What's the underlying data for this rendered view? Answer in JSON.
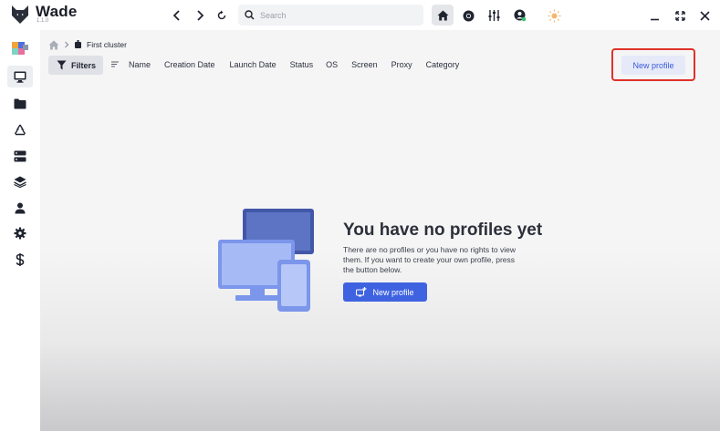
{
  "app": {
    "name": "Wade",
    "version": "1.1.0"
  },
  "search": {
    "placeholder": "Search"
  },
  "toolbar": {
    "icons": [
      "chevron-left-icon",
      "chevron-right-icon",
      "refresh-icon",
      "home-icon",
      "chrome-icon",
      "sliders-icon",
      "account-icon",
      "sun-icon",
      "minimize-icon",
      "expand-icon",
      "close-icon"
    ]
  },
  "sidebar": {
    "items": [
      {
        "icon": "avatar-grid-icon"
      },
      {
        "icon": "monitor-icon",
        "active": true
      },
      {
        "icon": "folder-icon"
      },
      {
        "icon": "recycle-icon"
      },
      {
        "icon": "server-icon"
      },
      {
        "icon": "layers-icon"
      },
      {
        "icon": "user-icon"
      },
      {
        "icon": "gear-icon"
      },
      {
        "icon": "dollar-icon"
      }
    ]
  },
  "breadcrumb": {
    "current": "First cluster"
  },
  "filters": {
    "label": "Filters"
  },
  "columns": [
    "Name",
    "Creation Date",
    "Launch Date",
    "Status",
    "OS",
    "Screen",
    "Proxy",
    "Category"
  ],
  "header_button": {
    "label": "New profile"
  },
  "empty_state": {
    "title": "You have no profiles yet",
    "text": "There are no profiles or you have no rights to view them. If you want to create your own profile, press the button below.",
    "button_label": "New profile"
  },
  "colors": {
    "accent": "#3f63e0",
    "highlight": "#e0322a",
    "illustration_dark": "#4257a8",
    "illustration_light": "#8ea7f0"
  }
}
